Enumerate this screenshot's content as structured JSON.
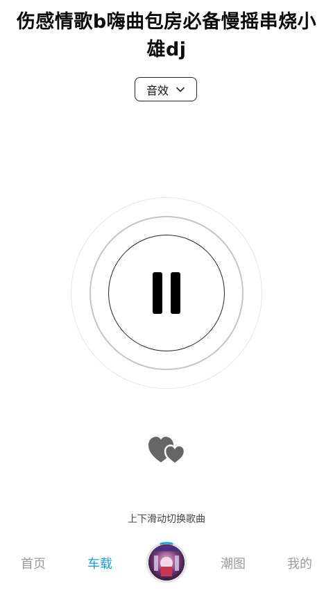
{
  "song": {
    "title": "伤感情歌b嗨曲包房必备慢摇串烧小雄dj"
  },
  "effect": {
    "label": "音效",
    "icon": "chevron-down-icon"
  },
  "player": {
    "state": "playing",
    "icon": "pause-icon"
  },
  "favorite": {
    "icon": "double-heart-icon"
  },
  "hint": "上下滑动切换歌曲",
  "tabs": [
    {
      "label": "首页",
      "active": false
    },
    {
      "label": "车载",
      "active": true
    },
    {
      "label": "潮图",
      "active": false
    },
    {
      "label": "我的",
      "active": false
    }
  ],
  "colors": {
    "accent": "#1aa0d8",
    "tab_inactive": "#9a9a9a",
    "heart": "#666666"
  }
}
